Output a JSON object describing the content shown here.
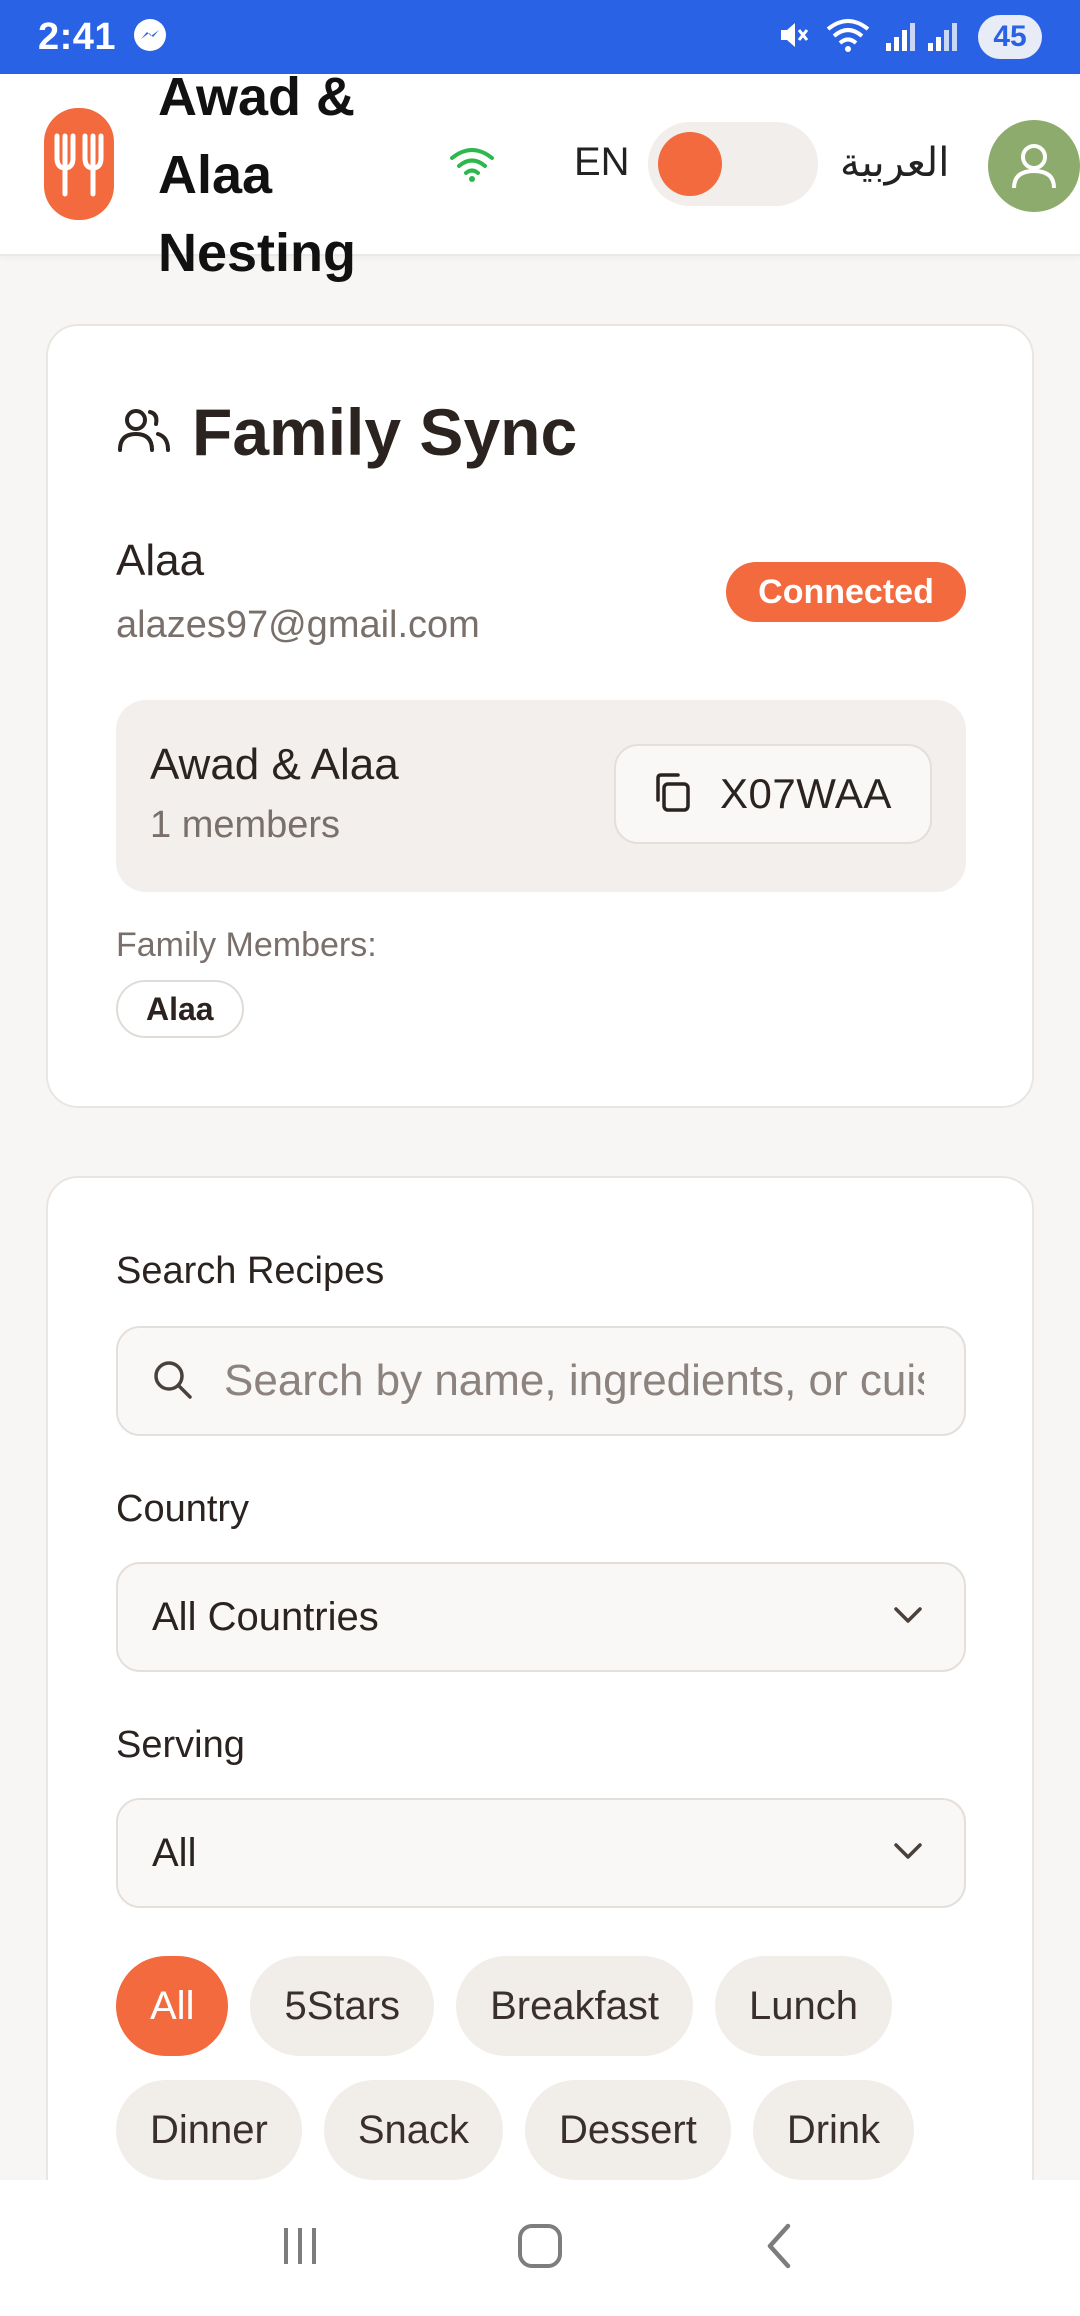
{
  "status_bar": {
    "time": "2:41",
    "battery": "45"
  },
  "header": {
    "title": "Awad & Alaa Nesting",
    "lang_en": "EN",
    "lang_ar": "العربية"
  },
  "family_sync": {
    "title": "Family Sync",
    "user_name": "Alaa",
    "user_email": "alazes97@gmail.com",
    "status": "Connected",
    "family_name": "Awad & Alaa",
    "member_count": "1 members",
    "family_code": "X07WAA",
    "members_label": "Family Members:",
    "members": [
      "Alaa"
    ]
  },
  "filters": {
    "search_label": "Search Recipes",
    "search_placeholder": "Search by name, ingredients, or cuisine...",
    "country_label": "Country",
    "country_value": "All Countries",
    "serving_label": "Serving",
    "serving_value": "All",
    "categories": [
      "All",
      "5Stars",
      "Breakfast",
      "Lunch",
      "Dinner",
      "Snack",
      "Dessert",
      "Drink"
    ],
    "active_category": "All"
  },
  "colors": {
    "status_bar": "#2a62e6",
    "accent": "#f26a3d",
    "avatar": "#8cab6c",
    "wifi": "#2db84d"
  },
  "icons": [
    "messenger-icon",
    "mute-icon",
    "wifi-icon",
    "signal-icon",
    "fork-knife-logo-icon",
    "wifi-status-icon",
    "user-avatar-icon",
    "users-icon",
    "copy-icon",
    "search-icon",
    "chevron-down-icon",
    "recent-apps-icon",
    "home-icon",
    "back-icon"
  ]
}
